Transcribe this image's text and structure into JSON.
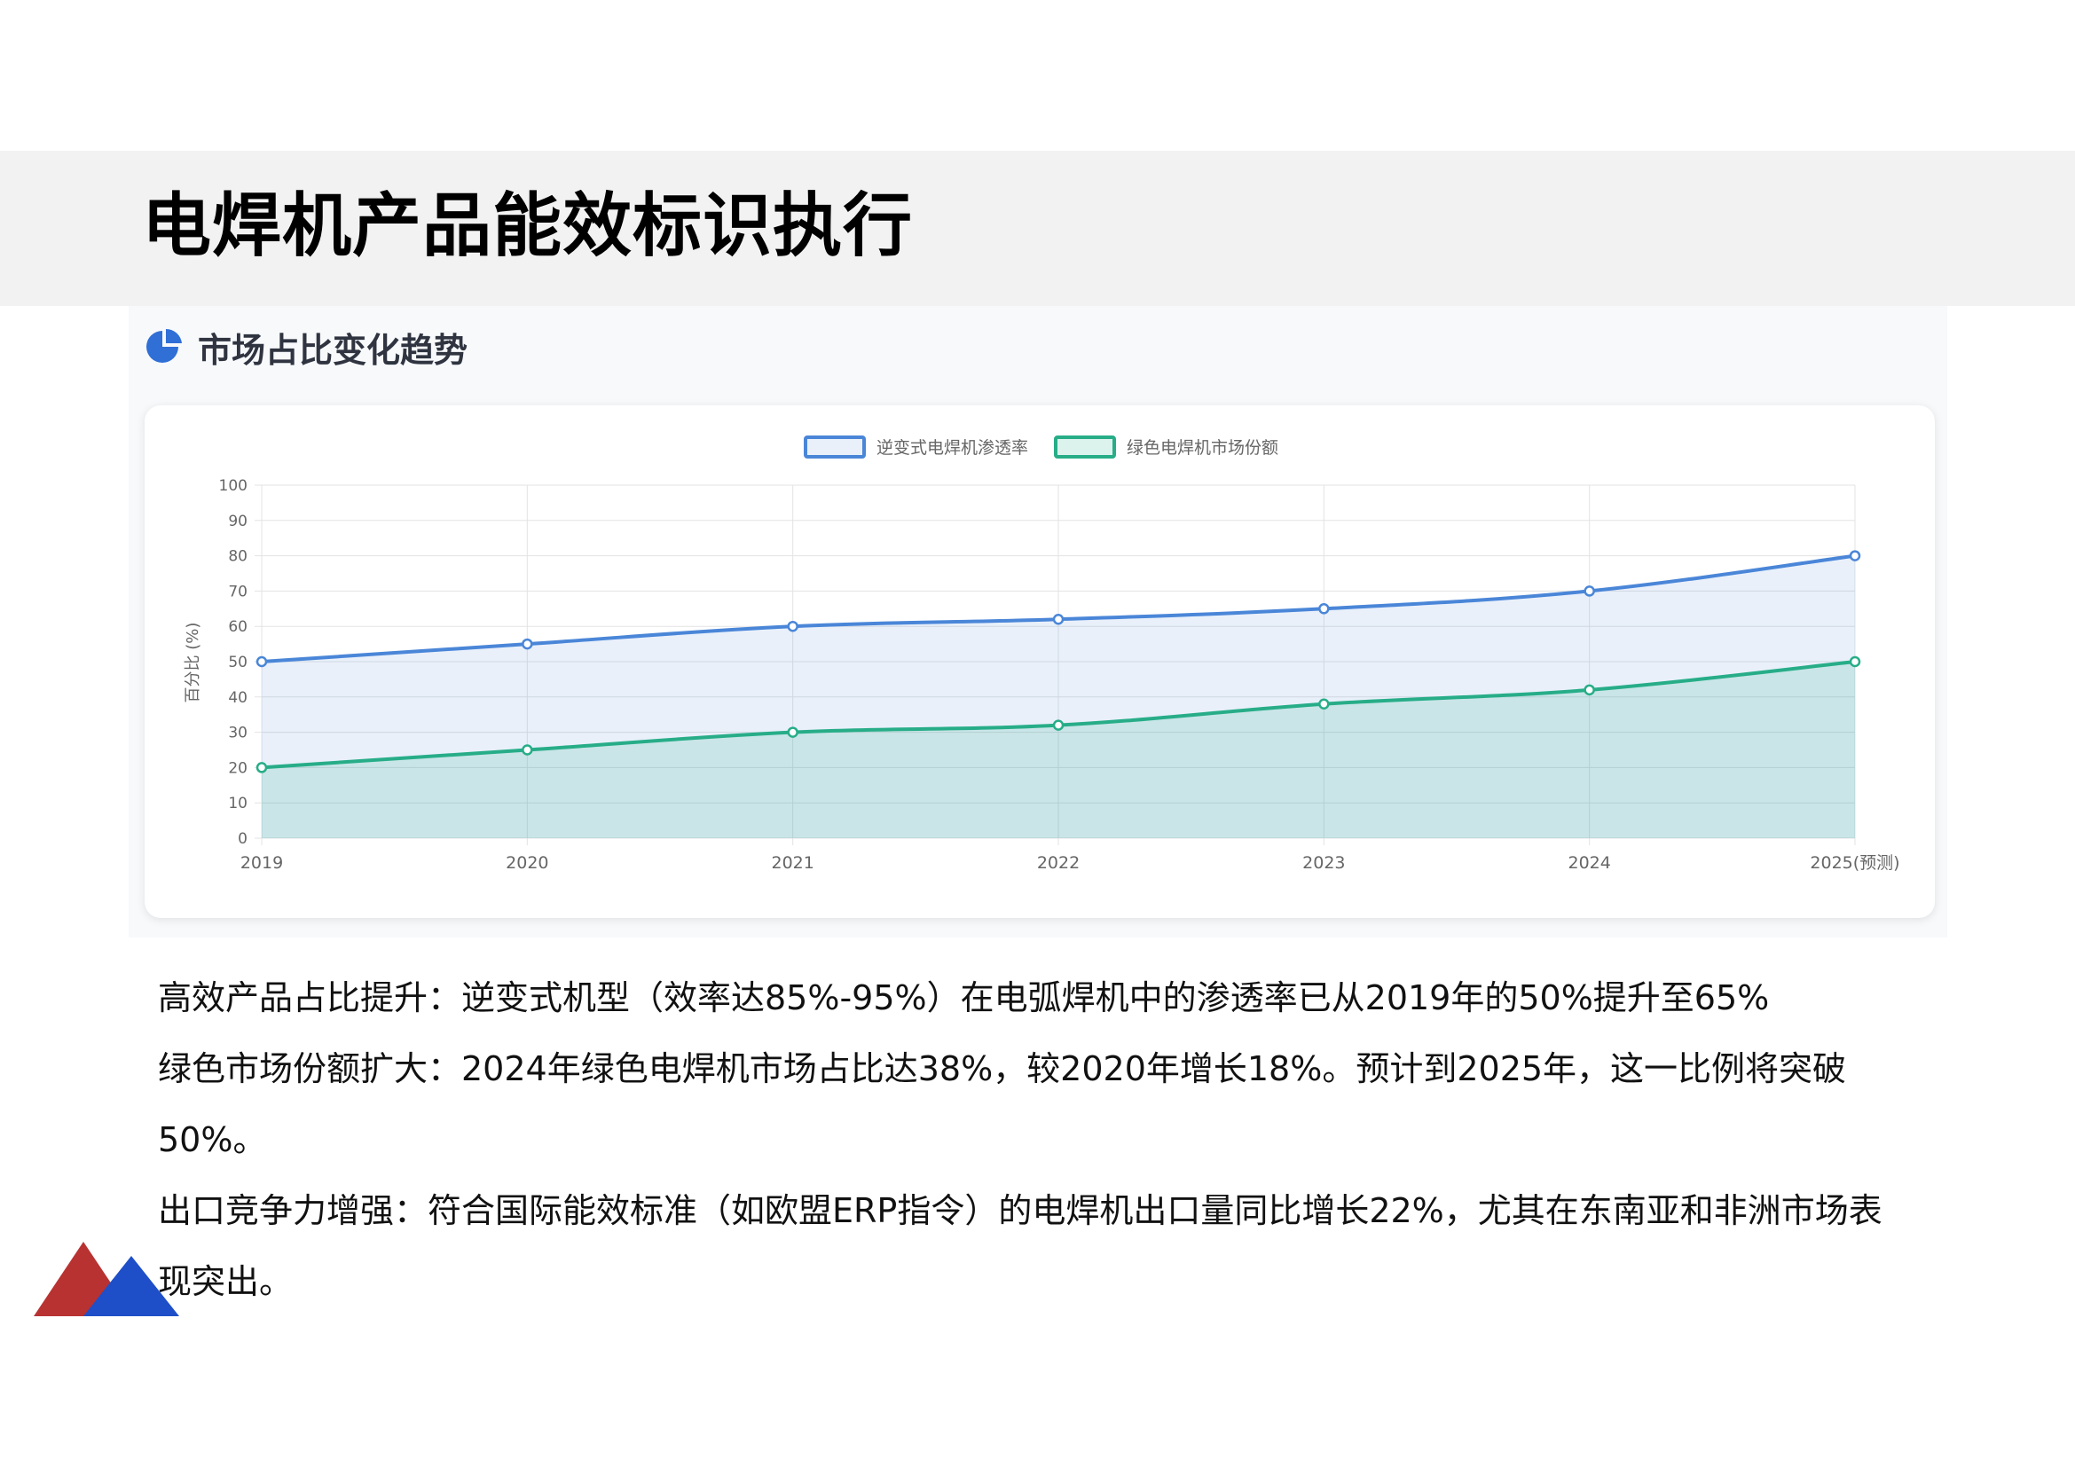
{
  "page": {
    "title": "电焊机产品能效标识执行",
    "section_title": "市场占比变化趋势",
    "section_icon": "pie-chart-icon",
    "notes": [
      "高效产品占比提升：逆变式机型（效率达85%-95%）在电弧焊机中的渗透率已从2019年的50%提升至65%",
      "绿色市场份额扩大：2024年绿色电焊机市场占比达38%，较2020年增长18%。预计到2025年，这一比例将突破50%。",
      "出口竞争力增强：符合国际能效标准（如欧盟ERP指令）的电焊机出口量同比增长22%，尤其在东南亚和非洲市场表",
      "现突出。"
    ],
    "colors": {
      "accent_blue": "#4a86d8",
      "accent_green": "#27ad88",
      "logo_red": "#b83232",
      "logo_blue": "#1e4fc8"
    }
  },
  "chart_data": {
    "type": "area",
    "title": "",
    "xlabel": "",
    "ylabel": "百分比 (%)",
    "categories": [
      "2019",
      "2020",
      "2021",
      "2022",
      "2023",
      "2024",
      "2025(预测)"
    ],
    "ylim": [
      0,
      100
    ],
    "yticks": [
      0,
      10,
      20,
      30,
      40,
      50,
      60,
      70,
      80,
      90,
      100
    ],
    "grid": true,
    "legend_position": "top-center",
    "series": [
      {
        "name": "逆变式电焊机渗透率",
        "values": [
          50,
          55,
          60,
          62,
          65,
          70,
          80
        ],
        "color": "#4a86d8",
        "fill": "rgba(74,134,216,0.12)"
      },
      {
        "name": "绿色电焊机市场份额",
        "values": [
          20,
          25,
          30,
          32,
          38,
          42,
          50
        ],
        "color": "#27ad88",
        "fill": "rgba(39,173,136,0.16)"
      }
    ]
  }
}
